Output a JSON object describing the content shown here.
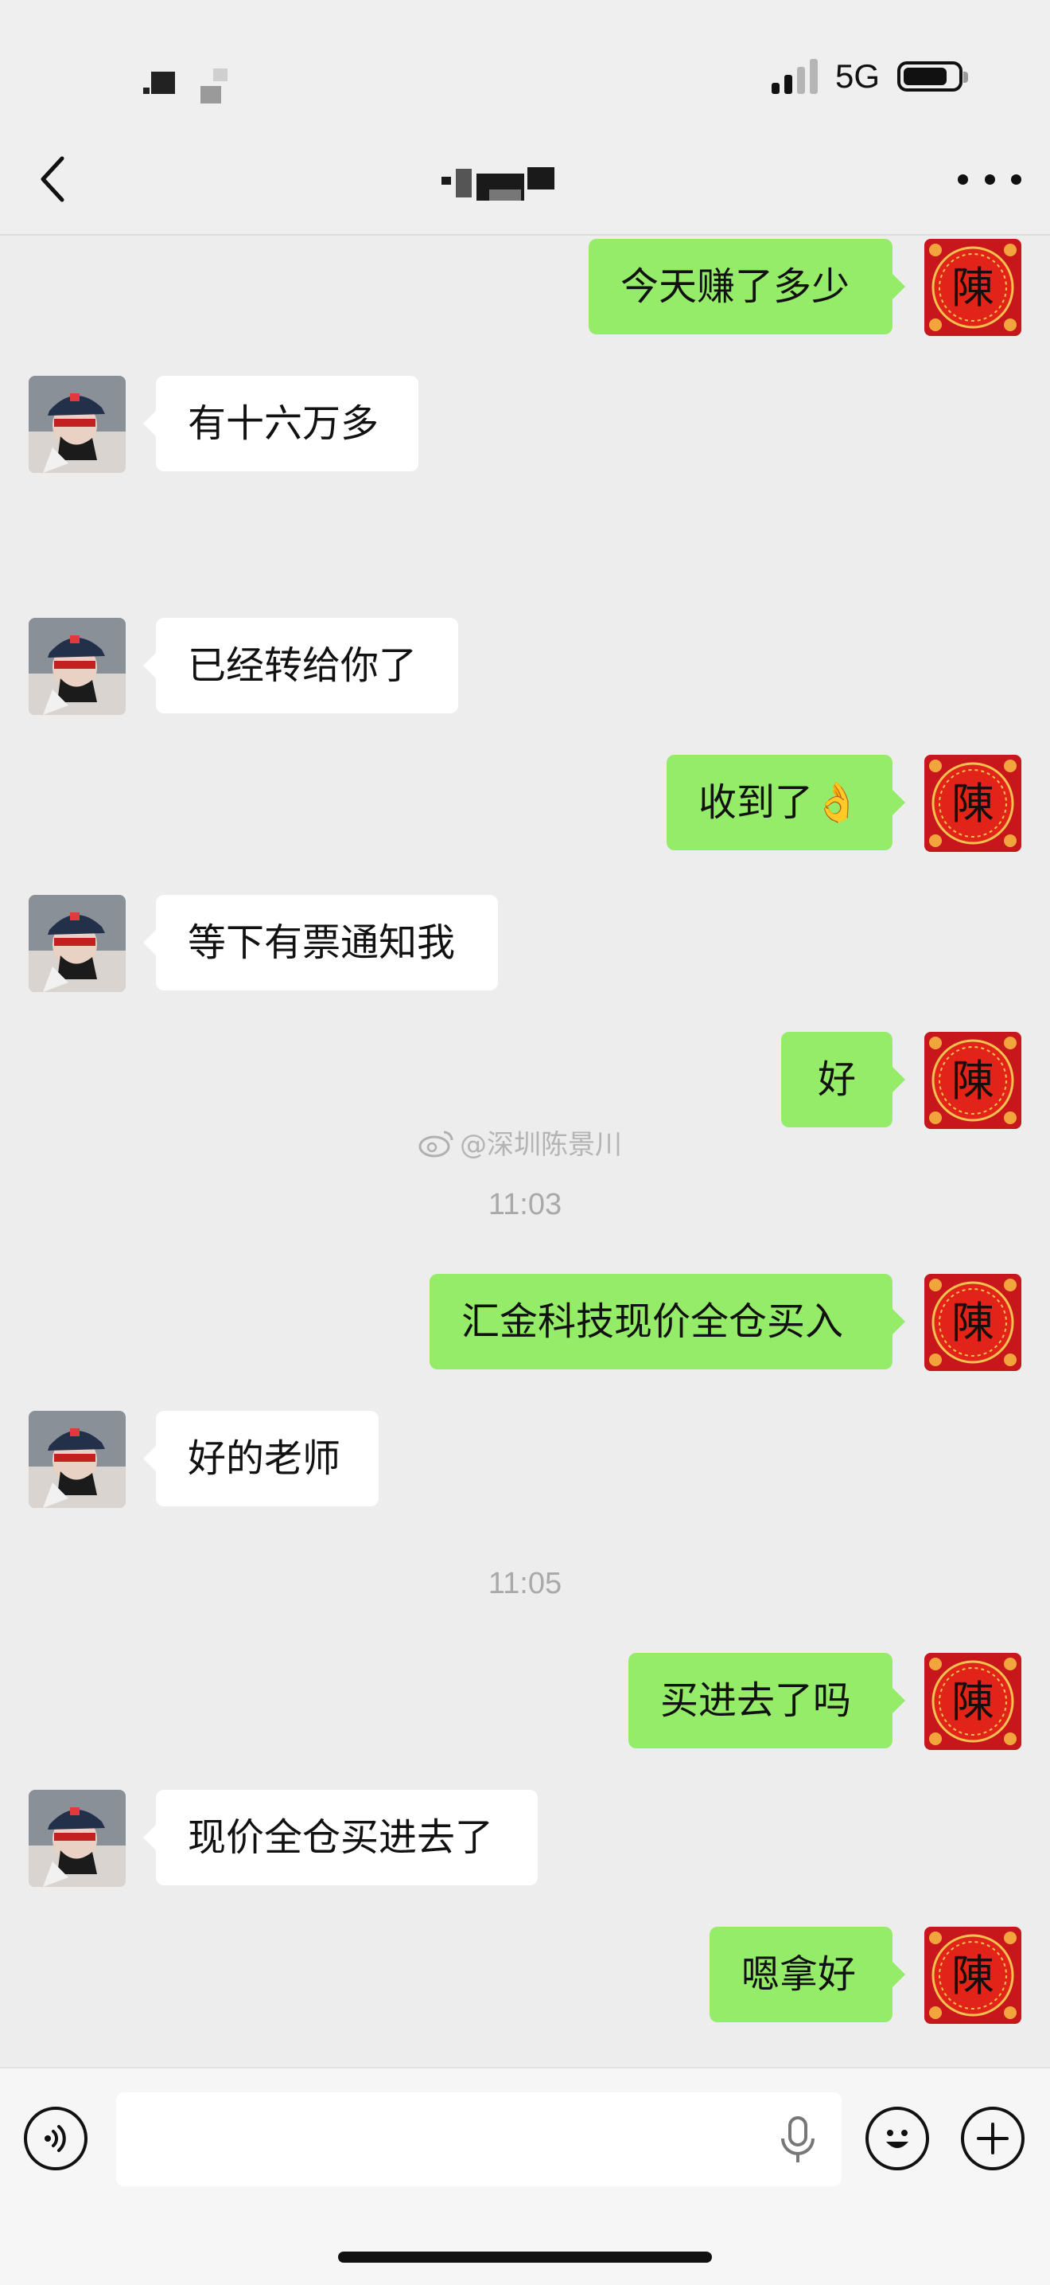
{
  "status_bar": {
    "network": "5G",
    "battery_level": 0.82
  },
  "header": {
    "back_icon": "chevron-left-icon",
    "more_icon": "ellipsis-icon"
  },
  "messages": [
    {
      "side": "out",
      "text": "今天赚了多少"
    },
    {
      "side": "in",
      "text": "有十六万多"
    },
    {
      "side": "in",
      "text": "已经转给你了"
    },
    {
      "side": "out",
      "text": "收到了👌"
    },
    {
      "side": "in",
      "text": "等下有票通知我"
    },
    {
      "side": "out",
      "text": "好"
    },
    {
      "side": "out",
      "text": "汇金科技现价全仓买入"
    },
    {
      "side": "in",
      "text": "好的老师"
    },
    {
      "side": "out",
      "text": "买进去了吗"
    },
    {
      "side": "in",
      "text": "现价全仓买进去了"
    },
    {
      "side": "out",
      "text": "嗯拿好"
    }
  ],
  "timestamps": [
    "11:03",
    "11:05"
  ],
  "watermark": "@深圳陈景川",
  "self_avatar_char": "陳",
  "input_bar": {
    "voice_icon": "voice-icon",
    "emoji_icon": "emoji-icon",
    "plus_icon": "plus-icon",
    "mic_icon": "mic-icon",
    "value": ""
  },
  "colors": {
    "outgoing_bubble": "#95ec69",
    "incoming_bubble": "#ffffff",
    "background": "#ededed"
  }
}
